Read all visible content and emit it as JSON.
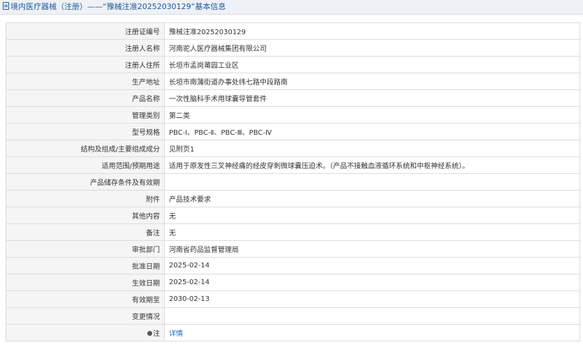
{
  "header": {
    "title": "境内医疗器械（注册）——“豫械注准20252030129”基本信息"
  },
  "rows": [
    {
      "label": "注册证编号",
      "value": "豫械注准20252030129"
    },
    {
      "label": "注册人名称",
      "value": "河南驼人医疗器械集团有限公司"
    },
    {
      "label": "注册人住所",
      "value": "长垣市孟岗莆园工业区"
    },
    {
      "label": "生产地址",
      "value": "长垣市南蒲街道办事处纬七路中段路南"
    },
    {
      "label": "产品名称",
      "value": "一次性脑科手术用球囊导管套件"
    },
    {
      "label": "管理类别",
      "value": "第二类"
    },
    {
      "label": "型号规格",
      "value": "PBC-Ⅰ、PBC-Ⅱ、PBC-Ⅲ、PBC-Ⅳ"
    },
    {
      "label": "结构及组成/主要组成成分",
      "value": "见附页1"
    },
    {
      "label": "适用范围/预期用途",
      "value": "适用于原发性三叉神经痛的经皮穿刺微球囊压迫术。（产品不接触血液循环系统和中枢神经系统）。"
    },
    {
      "label": "产品储存条件及有效期",
      "value": ""
    },
    {
      "label": "附件",
      "value": "产品技术要求"
    },
    {
      "label": "其他内容",
      "value": "无"
    },
    {
      "label": "备注",
      "value": "无"
    },
    {
      "label": "审批部门",
      "value": "河南省药品监督管理局"
    },
    {
      "label": "批准日期",
      "value": "2025-02-14"
    },
    {
      "label": "生效日期",
      "value": "2025-02-14"
    },
    {
      "label": "有效期至",
      "value": "2030-02-13"
    },
    {
      "label": "变更情况",
      "value": ""
    }
  ],
  "note_row": {
    "label": "注",
    "link_text": "详情"
  }
}
